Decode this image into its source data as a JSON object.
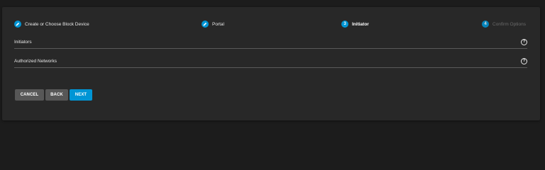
{
  "stepper": {
    "steps": [
      {
        "label": "Create or Choose Block Device",
        "state": "done",
        "icon": "pencil-icon"
      },
      {
        "label": "Portal",
        "state": "done",
        "icon": "pencil-icon"
      },
      {
        "number": "3",
        "label": "Initiator",
        "state": "active"
      },
      {
        "number": "4",
        "label": "Confirm Options",
        "state": "pending"
      }
    ]
  },
  "form": {
    "initiators": {
      "label": "Initiators",
      "help_icon": "help-circle-icon"
    },
    "authorized_networks": {
      "label": "Authorized Networks",
      "help_icon": "help-circle-icon"
    },
    "help_glyph": "?"
  },
  "actions": {
    "cancel_label": "CANCEL",
    "back_label": "BACK",
    "next_label": "NEXT"
  },
  "colors": {
    "accent": "#0095d5",
    "background": "#1c1c1c",
    "card": "#282828",
    "secondary_button": "#575757"
  }
}
